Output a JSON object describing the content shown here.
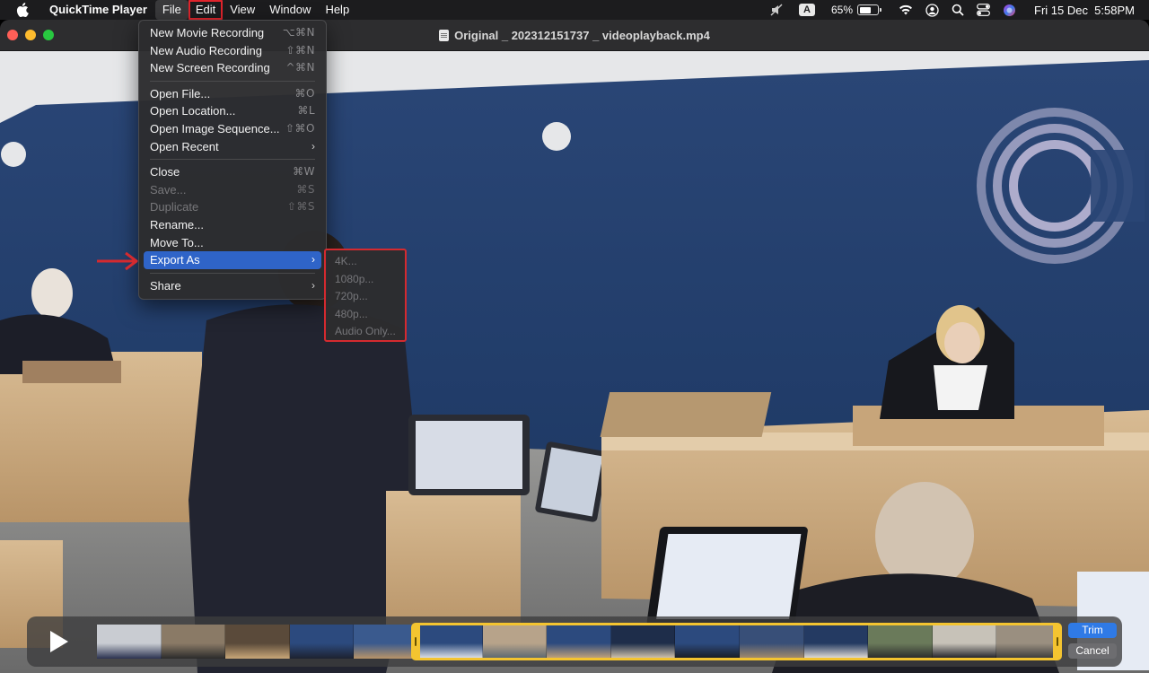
{
  "menubar": {
    "app_name": "QuickTime Player",
    "items": [
      "File",
      "Edit",
      "View",
      "Window",
      "Help"
    ],
    "status": {
      "keyboard_input": "A",
      "battery_percent": "65%",
      "battery_level": 0.65,
      "datetime": "Fri 15 Dec  5:58PM"
    },
    "icons": [
      "apple-icon",
      "mute-icon",
      "wifi-icon",
      "user-icon",
      "search-icon",
      "control-center-icon",
      "siri-icon"
    ]
  },
  "window": {
    "title": "Original _ 202312151737 _ videoplayback.mp4"
  },
  "file_menu": {
    "items": [
      {
        "label": "New Movie Recording",
        "shortcut": "⌥⌘N",
        "enabled": true
      },
      {
        "label": "New Audio Recording",
        "shortcut": "⇧⌘N",
        "enabled": true
      },
      {
        "label": "New Screen Recording",
        "shortcut": "^⌘N",
        "enabled": true
      },
      {
        "label": "Open File...",
        "shortcut": "⌘O",
        "enabled": true
      },
      {
        "label": "Open Location...",
        "shortcut": "⌘L",
        "enabled": true
      },
      {
        "label": "Open Image Sequence...",
        "shortcut": "⇧⌘O",
        "enabled": true
      },
      {
        "label": "Open Recent",
        "submenu": true,
        "enabled": true
      },
      {
        "label": "Close",
        "shortcut": "⌘W",
        "enabled": true
      },
      {
        "label": "Save...",
        "shortcut": "⌘S",
        "enabled": false
      },
      {
        "label": "Duplicate",
        "shortcut": "⇧⌘S",
        "enabled": false
      },
      {
        "label": "Rename...",
        "enabled": true
      },
      {
        "label": "Move To...",
        "enabled": true
      },
      {
        "label": "Export As",
        "submenu": true,
        "enabled": true,
        "highlighted": true
      },
      {
        "label": "Share",
        "submenu": true,
        "enabled": true
      }
    ]
  },
  "export_submenu": {
    "items": [
      "4K...",
      "1080p...",
      "720p...",
      "480p...",
      "Audio Only..."
    ]
  },
  "trim_bar": {
    "trim_label": "Trim",
    "cancel_label": "Cancel",
    "thumbnail_count": 15
  },
  "colors": {
    "menu_highlight": "#2f64c8",
    "annotation_red": "#d42a2f",
    "trim_handle": "#f4c430",
    "trim_button": "#2f7ae6",
    "wall_blue": "#2c4a7e",
    "desk_wood": "#c7a57a"
  }
}
